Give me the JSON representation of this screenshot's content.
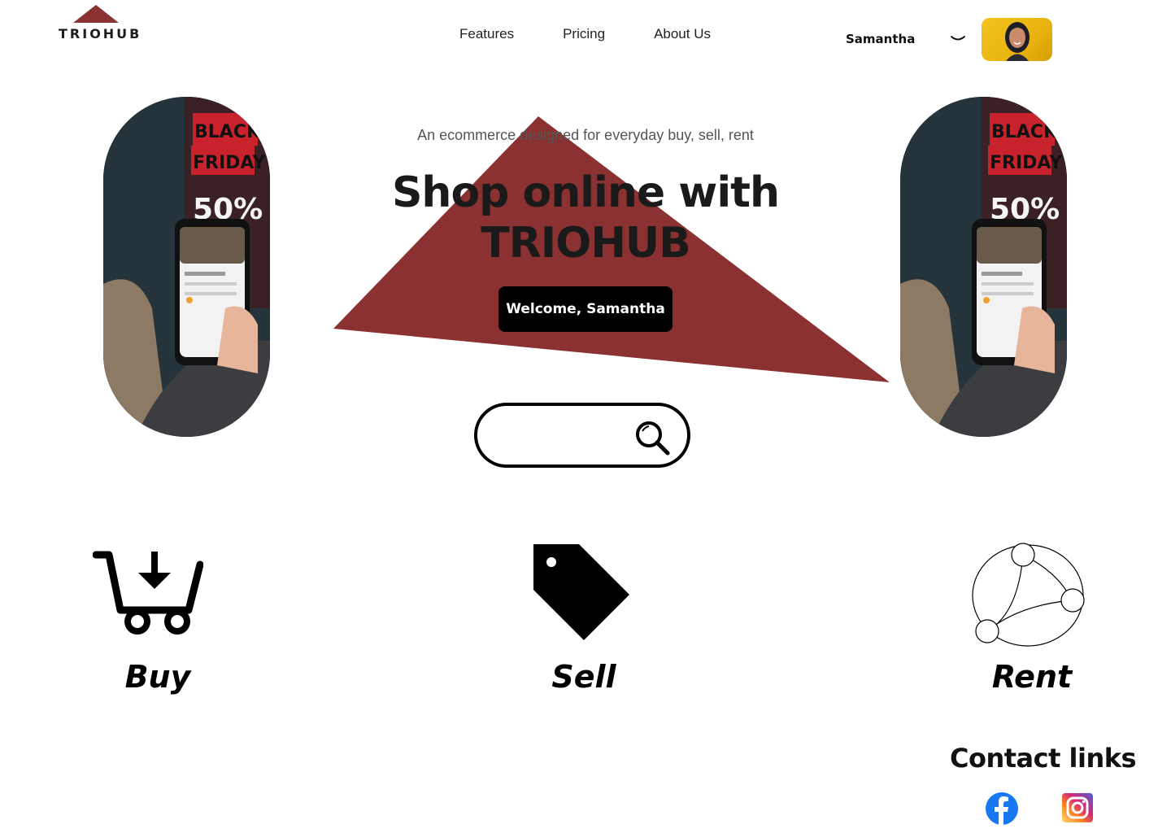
{
  "brand": {
    "name": "TRIOHUB",
    "accent": "#8b3131"
  },
  "nav": {
    "items": [
      "Features",
      "Pricing",
      "About Us"
    ]
  },
  "user": {
    "name": "Samantha"
  },
  "hero": {
    "tagline": "An ecommerce designed for everyday buy, sell, rent",
    "headline_line1": "Shop online with",
    "headline_line2": "TRIOHUB",
    "welcome_button": "Welcome, Samantha"
  },
  "search": {
    "placeholder": "",
    "icon": "search-icon"
  },
  "categories": [
    {
      "label": "Buy",
      "icon": "cart-download-icon"
    },
    {
      "label": "Sell",
      "icon": "price-tag-icon"
    },
    {
      "label": "Rent",
      "icon": "network-icon"
    }
  ],
  "contact": {
    "title": "Contact links",
    "links": [
      {
        "icon": "facebook-icon",
        "color": "#1877f2"
      },
      {
        "icon": "instagram-icon",
        "color": "#d62976"
      }
    ]
  },
  "pill_photo_text": {
    "line1": "BLACK",
    "line2": "FRIDAY",
    "line3": "50%"
  }
}
